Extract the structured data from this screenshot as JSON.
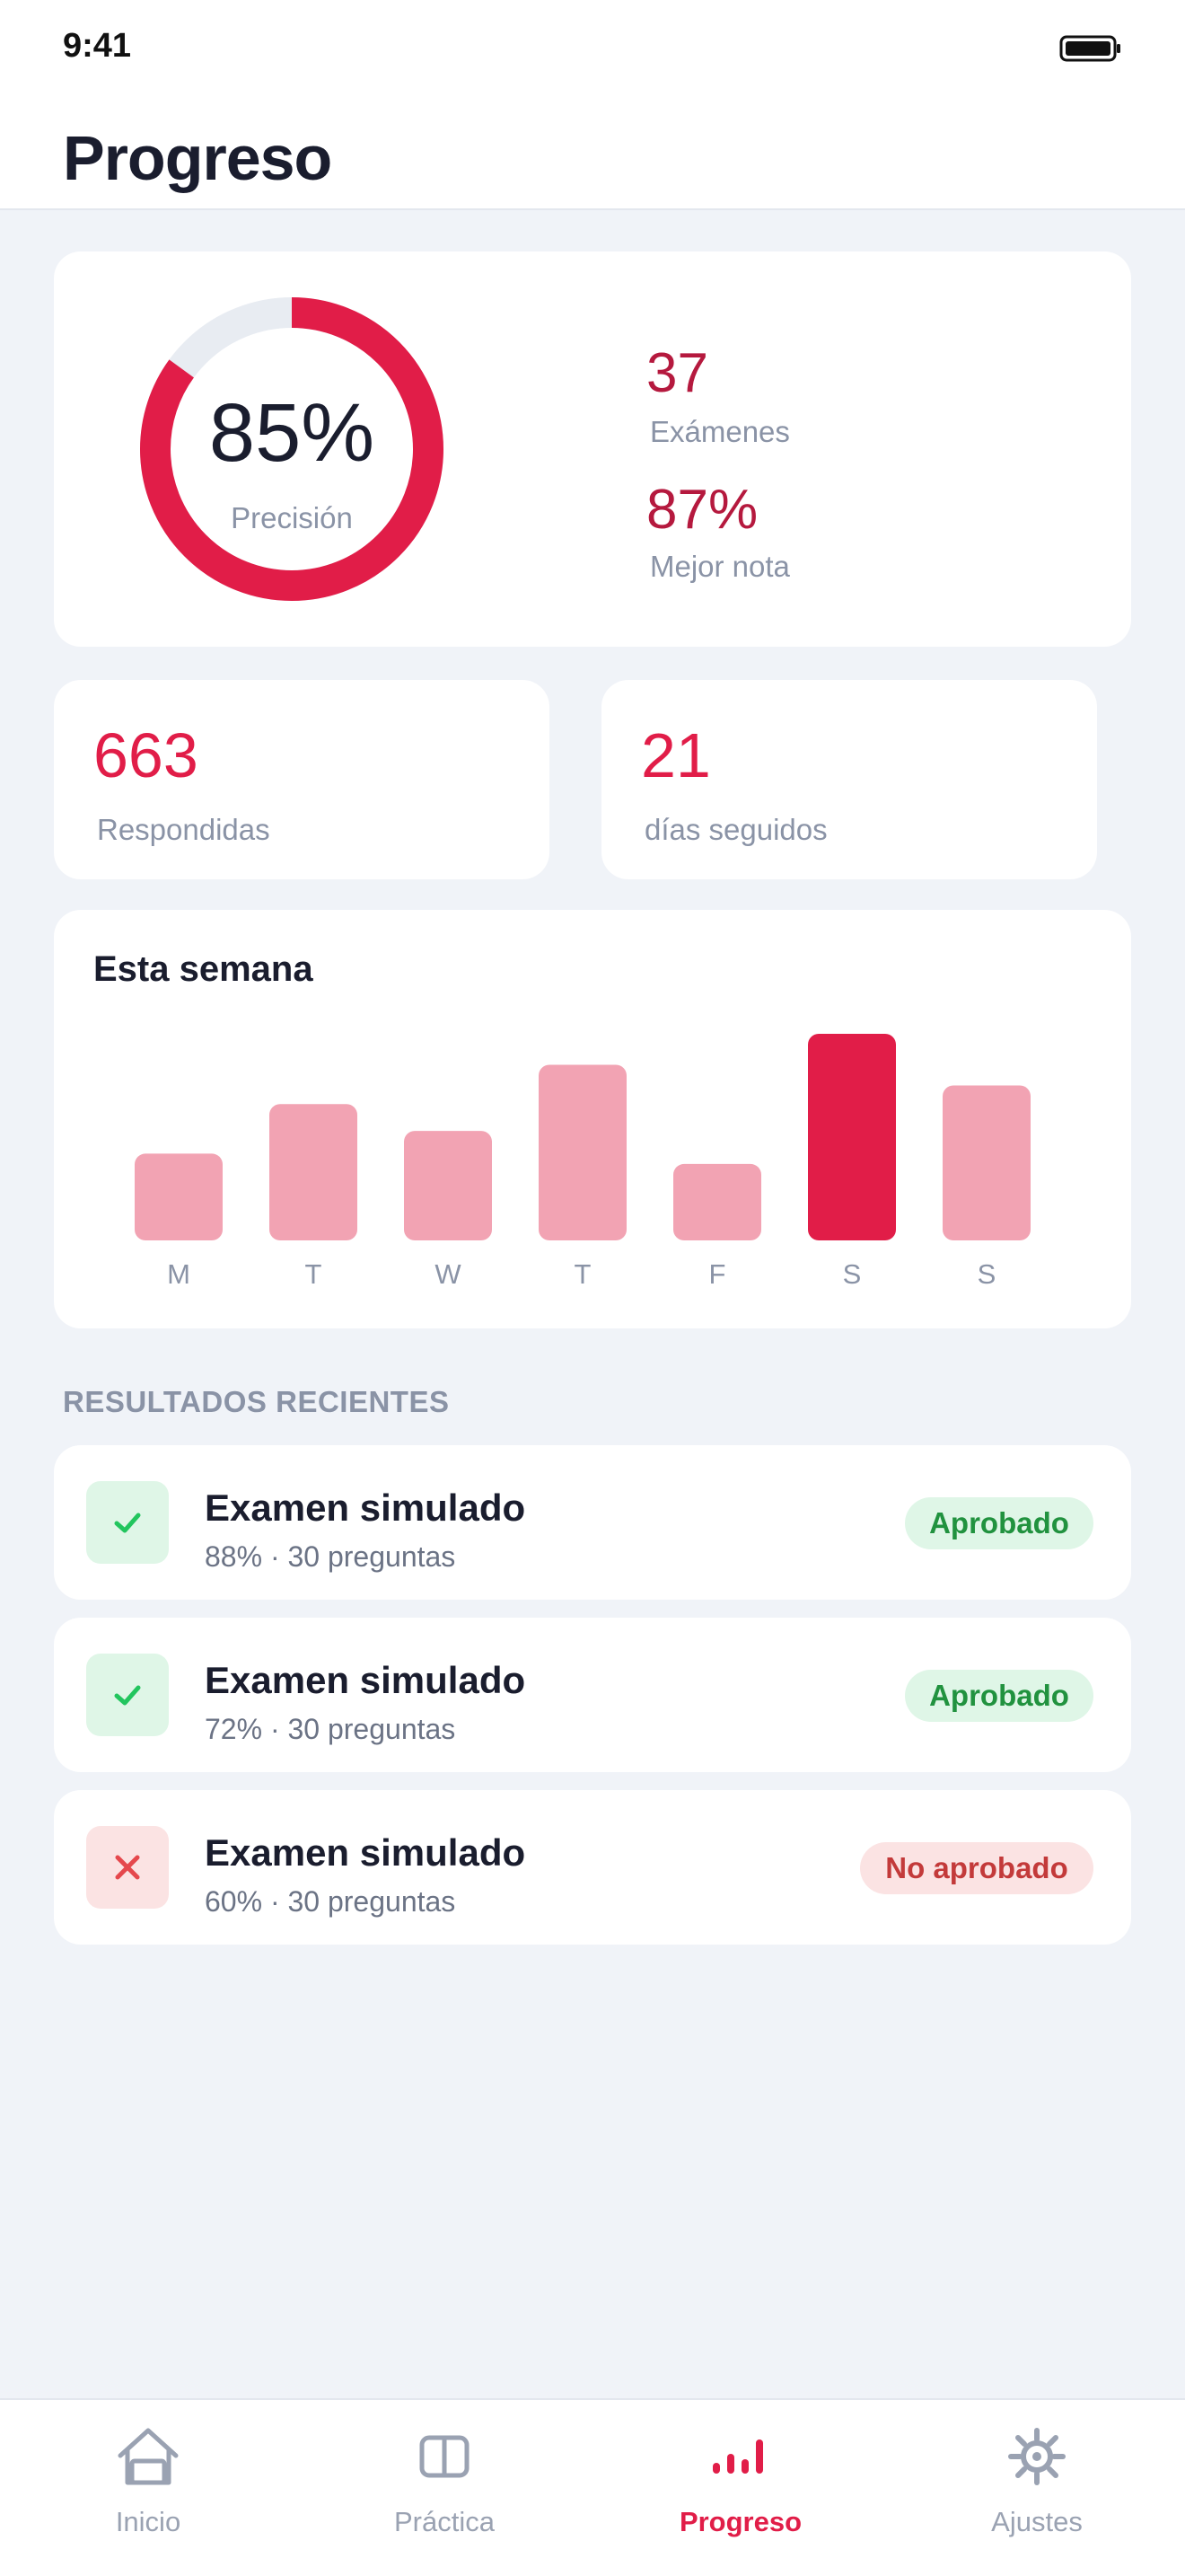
{
  "status": {
    "time": "9:41"
  },
  "header": {
    "title": "Progreso"
  },
  "summary": {
    "accuracy_value": "85%",
    "accuracy_label": "Precisión",
    "accuracy_fraction": 0.85,
    "exams_value": "37",
    "exams_label": "Exámenes",
    "best_value": "87%",
    "best_label": "Mejor nota"
  },
  "answered": {
    "value": "663",
    "label": "Respondidas"
  },
  "streak": {
    "value": "21",
    "label": "días seguidos"
  },
  "week": {
    "title": "Esta semana",
    "chart_data": {
      "type": "bar",
      "categories": [
        "M",
        "T",
        "W",
        "T",
        "F",
        "S",
        "S"
      ],
      "values": [
        42,
        66,
        53,
        85,
        37,
        100,
        75
      ],
      "highlight_index": 5,
      "ylim": [
        0,
        100
      ],
      "grid": false,
      "colors": {
        "bar": "#f2a3b3",
        "highlight": "#e11d48"
      }
    }
  },
  "recent": {
    "section_title": "RESULTADOS RECIENTES",
    "items": [
      {
        "title": "Examen simulado",
        "subtitle": "88% · 30 preguntas",
        "badge": "Aprobado",
        "status": "pass",
        "icon": "check-icon"
      },
      {
        "title": "Examen simulado",
        "subtitle": "72% · 30 preguntas",
        "badge": "Aprobado",
        "status": "pass",
        "icon": "check-icon"
      },
      {
        "title": "Examen simulado",
        "subtitle": "60% · 30 preguntas",
        "badge": "No aprobado",
        "status": "fail",
        "icon": "x-icon"
      }
    ]
  },
  "tabs": [
    {
      "label": "Inicio",
      "icon": "home-icon",
      "active": false
    },
    {
      "label": "Práctica",
      "icon": "book-icon",
      "active": false
    },
    {
      "label": "Progreso",
      "icon": "bar-chart-icon",
      "active": true
    },
    {
      "label": "Ajustes",
      "icon": "gear-icon",
      "active": false
    }
  ],
  "colors": {
    "accent": "#e11d48",
    "accent_dark": "#b5193e",
    "pass_bg": "#dff6e7",
    "pass_fg": "#21923f",
    "fail_bg": "#fbe3e3",
    "fail_fg": "#c33a3a",
    "muted": "#8a93a6"
  }
}
